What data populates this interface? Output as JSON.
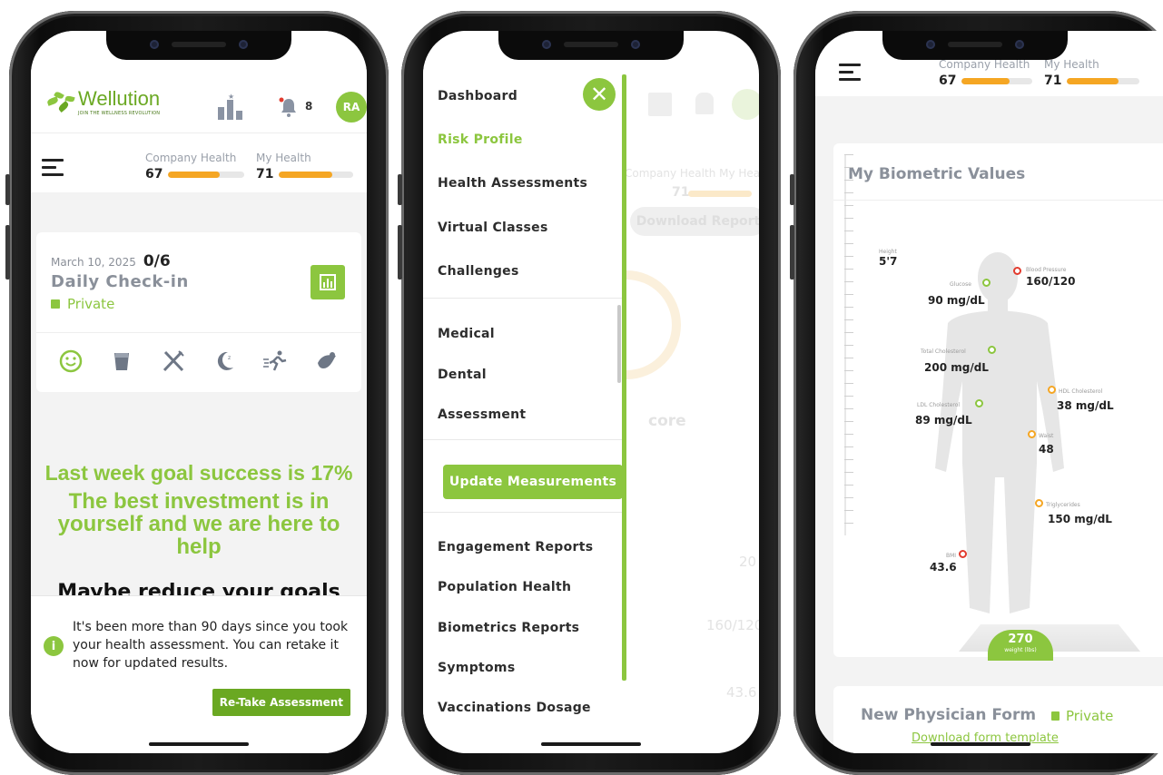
{
  "phone1": {
    "brand": {
      "name": "Wellution",
      "tagline": "JOIN THE WELLNESS REVOLUTION"
    },
    "notifications_count": "8",
    "avatar_initials": "RA",
    "company_health": {
      "label": "Company Health",
      "value": "67",
      "fill": 0.67
    },
    "my_health": {
      "label": "My Health",
      "value": "71",
      "fill": 0.71
    },
    "checkin": {
      "date": "March 10, 2025",
      "count": "0/6",
      "title": "Daily Check-in",
      "privacy": "Private"
    },
    "habit_icons": [
      "smile-icon",
      "water-glass-icon",
      "food-cutlery-icon",
      "sleep-moon-icon",
      "running-icon",
      "meditation-icon"
    ],
    "goal_success": "Last week goal success is 17%",
    "motivation": "The best investment is in yourself and we are here to help",
    "reduce_goals": "Maybe reduce your goals",
    "notice": {
      "text": "It's been more than 90 days since you took your health assessment. You can retake it now for updated results.",
      "button": "Re-Take Assessment"
    }
  },
  "phone2": {
    "menu_group1": [
      "Dashboard",
      "Risk Profile",
      "Health Assessments",
      "Virtual Classes",
      "Challenges"
    ],
    "active_item": "Risk Profile",
    "menu_group2": [
      "Medical",
      "Dental",
      "Assessment"
    ],
    "update_button": "Update Measurements",
    "menu_group3": [
      "Engagement Reports",
      "Population Health",
      "Biometrics Reports",
      "Symptoms",
      "Vaccinations Dosage"
    ],
    "background": {
      "health_labels": "Company Health   My Health",
      "my_health_value": "71",
      "download_button": "Download Report",
      "score_text": "core",
      "values": [
        "20",
        "160/120",
        "43.6"
      ]
    }
  },
  "phone3": {
    "company_health": {
      "label": "Company Health",
      "value": "67",
      "fill": 0.67
    },
    "my_health": {
      "label": "My Health",
      "value": "71",
      "fill": 0.71
    },
    "biometric_title": "My Biometric Values",
    "height": {
      "label": "Height",
      "value": "5'7"
    },
    "metrics": [
      {
        "label": "Blood Pressure",
        "value": "160/120",
        "status": "red"
      },
      {
        "label": "Glucose",
        "value": "90 mg/dL",
        "status": "green"
      },
      {
        "label": "Total Cholesterol",
        "value": "200 mg/dL",
        "status": "green"
      },
      {
        "label": "HDL Cholesterol",
        "value": "38 mg/dL",
        "status": "orange"
      },
      {
        "label": "LDL Cholesterol",
        "value": "89 mg/dL",
        "status": "green"
      },
      {
        "label": "Waist",
        "value": "48",
        "status": "orange"
      },
      {
        "label": "Triglycerides",
        "value": "150 mg/dL",
        "status": "orange"
      },
      {
        "label": "BMI",
        "value": "43.6",
        "status": "red"
      }
    ],
    "weight": {
      "value": "270",
      "unit": "weight (lbs)"
    },
    "physician_form": {
      "title": "New Physician Form",
      "privacy": "Private",
      "link": "Download form template"
    }
  },
  "colors": {
    "brand_green": "#8cc63f",
    "dark_green": "#6aa822",
    "orange": "#f5a623",
    "red": "#e23b2e"
  }
}
